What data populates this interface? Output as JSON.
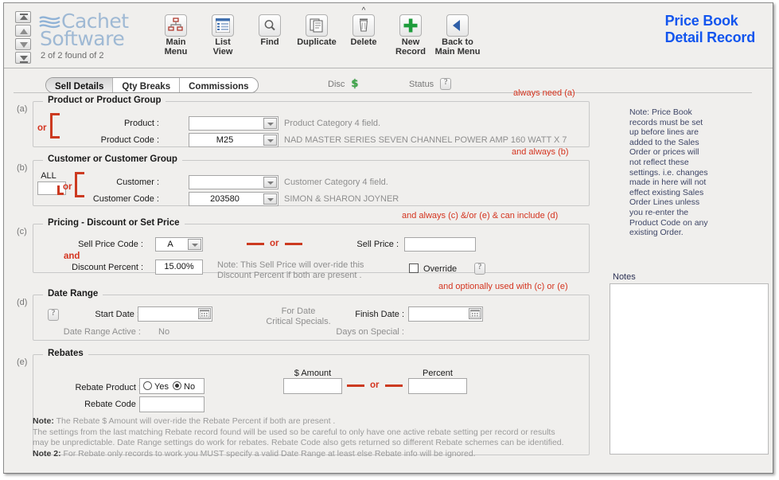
{
  "window": {
    "title": "Price Book Detail Record"
  },
  "header": {
    "logo_line1": "Cachet",
    "logo_line2": "Software",
    "record_count": "2 of 2 found of 2",
    "title_line1": "Price Book",
    "title_line2": "Detail Record",
    "nav_buttons": [
      {
        "name": "first-record",
        "glyph": "first"
      },
      {
        "name": "previous-record",
        "glyph": "prev"
      },
      {
        "name": "next-record",
        "glyph": "next"
      },
      {
        "name": "last-record",
        "glyph": "last"
      }
    ],
    "toolbar": [
      {
        "id": "main-menu",
        "line1": "Main",
        "line2": "Menu",
        "icon": "org-chart-icon"
      },
      {
        "id": "list-view",
        "line1": "List",
        "line2": "View",
        "icon": "list-icon"
      },
      {
        "id": "find",
        "line1": "Find",
        "line2": "",
        "icon": "magnifier-icon"
      },
      {
        "id": "duplicate",
        "line1": "Duplicate",
        "line2": "",
        "icon": "duplicate-icon"
      },
      {
        "id": "delete",
        "line1": "Delete",
        "line2": "",
        "icon": "trash-icon"
      },
      {
        "id": "new-record",
        "line1": "New",
        "line2": "Record",
        "icon": "plus-icon"
      },
      {
        "id": "back-to-main",
        "line1": "Back to",
        "line2": "Main Menu",
        "icon": "left-arrow-icon"
      }
    ]
  },
  "tabs": [
    {
      "label": "Sell Details",
      "active": true
    },
    {
      "label": "Qty Breaks",
      "active": false
    },
    {
      "label": "Commissions",
      "active": false
    }
  ],
  "status_bar": {
    "disc_label": "Disc",
    "disc_icon": "dollar-sign-icon",
    "disc_value": "$",
    "status_label": "Status",
    "status_icon": "help-icon"
  },
  "sections": {
    "a": {
      "letter": "(a)",
      "title": "Product or Product Group",
      "hint": "always need (a)",
      "or_label": "or",
      "product_label": "Product :",
      "product_value": "",
      "product_desc": "Product Category 4 field.",
      "product_code_label": "Product Code :",
      "product_code_value": "M25",
      "product_code_desc": "NAD MASTER SERIES SEVEN CHANNEL POWER AMP 160 WATT X 7"
    },
    "b": {
      "letter": "(b)",
      "title": "Customer or Customer Group",
      "hint": "and always (b)",
      "all_label": "ALL",
      "all_value": "",
      "or_label": "or",
      "customer_label": "Customer :",
      "customer_value": "",
      "customer_desc": "Customer Category 4 field.",
      "customer_code_label": "Customer Code :",
      "customer_code_value": "203580",
      "customer_code_desc": "SIMON & SHARON JOYNER"
    },
    "c": {
      "letter": "(c)",
      "title": "Pricing - Discount or Set Price",
      "hint": "and always (c) &/or (e) & can include (d)",
      "sell_price_code_label": "Sell Price Code :",
      "sell_price_code_value": "A",
      "and_label": "and",
      "discount_percent_label": "Discount Percent :",
      "discount_percent_value": "15.00%",
      "or_label": "or",
      "sell_price_label": "Sell Price :",
      "sell_price_value": "",
      "note_line1": "Note: This Sell Price will over-ride this",
      "note_line2": "Discount Percent if both are present .",
      "override_label": "Override",
      "override_checked": false
    },
    "d": {
      "letter": "(d)",
      "title": "Date Range",
      "hint": "and optionally used with (c) or (e)",
      "start_date_label": "Start Date :",
      "start_date_value": "",
      "finish_date_label": "Finish Date :",
      "finish_date_value": "",
      "center_note_line1": "For Date",
      "center_note_line2": "Critical Specials.",
      "date_range_active_label": "Date Range Active :",
      "date_range_active_value": "No",
      "days_on_special_label": "Days on Special :",
      "days_on_special_value": ""
    },
    "e": {
      "letter": "(e)",
      "title": "Rebates",
      "hint": "",
      "rebate_product_label": "Rebate Product :",
      "rebate_yes_label": "Yes",
      "rebate_no_label": "No",
      "rebate_selected": "No",
      "rebate_code_label": "Rebate Code :",
      "rebate_code_value": "",
      "amount_label": "$ Amount",
      "amount_value": "",
      "or_label": "or",
      "percent_label": "Percent",
      "percent_value": ""
    }
  },
  "bottom_note": {
    "note1_bold": "Note:",
    "note1_text": " The Rebate $ Amount will over-ride the Rebate Percent if both are present .",
    "line2": "The settings from the last matching Rebate record found will be used so be careful to only have one active rebate setting per record or results",
    "line3": "may be unpredictable.  Date Range settings do work for rebates.  Rebate Code also gets returned so different Rebate schemes can be identified.",
    "note2_bold": "Note 2:",
    "note2_text": " For Rebate only records to work you MUST specify a valid Date Range at least else Rebate info will be ignored."
  },
  "sidebar": {
    "note": "Note: Price Book records must be set up before lines are added to the Sales Order or prices will not reflect these settings. i.e. changes made in here will not effect existing Sales Order Lines unless you re-enter the Product Code on any existing Order.",
    "notes_label": "Notes",
    "notes_value": ""
  },
  "colors": {
    "accent_red": "#cc3a20",
    "title_blue": "#1255ee",
    "logo_blue": "#9fb9d4",
    "panel_bg": "#f0efed",
    "sidebar_text": "#3d4566"
  }
}
